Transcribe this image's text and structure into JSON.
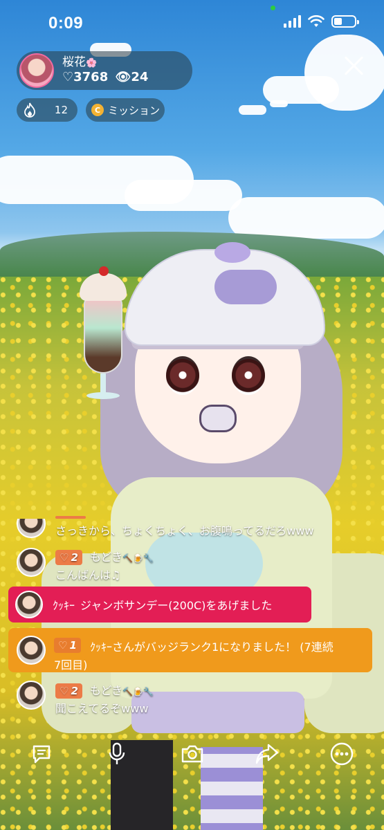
{
  "status_bar": {
    "time": "0:09"
  },
  "host": {
    "name": "桜花",
    "name_decoration": "🌸",
    "likes": "♡3768",
    "viewers": "👁24"
  },
  "pills": {
    "fire_count": "12",
    "mission_coin": "C",
    "mission_label": "ミッション"
  },
  "chat": {
    "messages": [
      {
        "text": "さっきから、ちょくちょく、お腹鳴ってるだろwww"
      },
      {
        "badge_level": "2",
        "user": "もどき",
        "user_emoji": "🔨🍺🔧",
        "text": "こんばんは♫"
      },
      {
        "user": "ｸｯｷｰ",
        "text": "ジャンボサンデー(200C)をあげました"
      },
      {
        "badge_level": "1",
        "text": "ｸｯｷｰさんがバッジランク1になりました！ (7連続",
        "text2": "7回目)"
      },
      {
        "badge_level": "2",
        "user": "もどき",
        "user_emoji": "🔨🍺🔧",
        "text": "聞こえてるぞwww"
      }
    ]
  },
  "icons": {
    "close": "close-icon",
    "fire": "fire-icon",
    "comment": "comment-icon",
    "mic": "mic-icon",
    "camera": "camera-icon",
    "share": "share-icon",
    "more": "more-icon"
  },
  "colors": {
    "gift_bar": "#e31e55",
    "rank_bar": "#f09a1c",
    "badge": "#ec7b47",
    "avatar_ring": "#f06aa0"
  }
}
